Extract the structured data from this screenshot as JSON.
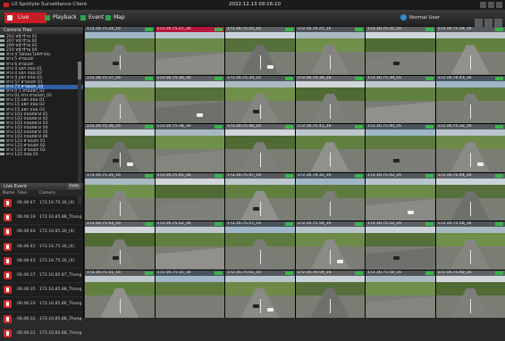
{
  "app": {
    "title": "L0 Spotlyte Surveillance Client",
    "clock": "2022.12.13 09:16:10"
  },
  "toolbar": {
    "tabs": [
      {
        "label": "Live"
      },
      {
        "label": "Playback"
      },
      {
        "label": "Event"
      },
      {
        "label": "Map"
      }
    ],
    "user_label": "Normal User"
  },
  "camera_tree": {
    "title": "Camera Tree",
    "items": [
      "203 หน้าร้าน 01",
      "207 หน้าร้าน 02",
      "209 หน้าร้าน 03",
      "210 หน้าร้าน 04",
      "ทาง 4 ไปถนน ไม่ทราบน",
      "ทาง 5 สามแยก",
      "ทาง 6 สามแยก",
      "ทาง 4 แยก ถนน 01",
      "ทาง 4 แยก ถนน 02",
      "ทาง 4 แยก ถนน 03",
      "ทาง 57 สามแยก 01",
      "ทาง 73 สามแยก_02",
      "ทาง 0 1 สามแยก_01",
      "ทาง 01 ทาง สามแยก_02",
      "ทาง 15 แยก ถนน 01",
      "ทาง 15 แยก ถนน 02",
      "ทาง 15 แยก ถนน 03",
      "ทาง 103 ถนนหลวง 01",
      "ทาง 103 ถนนหลวง 02",
      "ทาง 103 ถนนหลวง 03",
      "ทาง 103 ถนนหลวง 04",
      "ทาง 103 ถนนหลวง 05",
      "ทาง 103 ถนนหลวง 06",
      "ทาง 123 สามแยก 01",
      "ทาง 123 สามแยก 02",
      "ทาง 123 สามแยก 03",
      "ทาง 123 ถนน 01"
    ],
    "selected_index": 11
  },
  "live_event": {
    "title": "Live Event",
    "auto_label": "Auto",
    "columns": {
      "icon": "Name",
      "time": "Time",
      "camera": "Camera"
    },
    "rows": [
      {
        "time": "06:46:47",
        "camera": "172.16.75.30_(4)"
      },
      {
        "time": "06:46:19",
        "camera": "172.16.85.88_Thong"
      },
      {
        "time": "06:46:44",
        "camera": "172.16.85.30_(4)"
      },
      {
        "time": "06:46:42",
        "camera": "172.16.75.30_(4)"
      },
      {
        "time": "06:46:43",
        "camera": "172.16.75.30_(4)"
      },
      {
        "time": "06:46:37",
        "camera": "172.16.85.87_Thong"
      },
      {
        "time": "06:46:35",
        "camera": "172.16.85.88_Thong"
      },
      {
        "time": "06:46:33",
        "camera": "172.16.85.86_Thong"
      },
      {
        "time": "06:46:32",
        "camera": "172.16.85.88_Thong"
      },
      {
        "time": "06:46:31",
        "camera": "172.16.85.88_Thong"
      }
    ]
  },
  "cameras": [
    "172.16.75.24_16",
    "172.16.75.27_16",
    "172.16.75.25_16",
    "172.16.70.25_16",
    "172.16.75.31_16",
    "172.16.75.29_16",
    "172.16.75.37_16",
    "172.16.75.30_16",
    "172.16.75.34_16",
    "172.16.70.34_16",
    "172.16.75.39_16",
    "172.16.70.43_16",
    "172.16.75.36_16",
    "172.16.75.38_16",
    "172.16.75.46_16",
    "172.16.75.41_16",
    "172.16.75.40_16",
    "172.16.75.32_16",
    "172.16.75.35_16",
    "172.16.75.45_16",
    "172.16.75.47_16",
    "172.16.70.32_16",
    "172.16.75.42_16",
    "172.16.75.44_16",
    "172.16.75.43_16",
    "172.16.75.53_16",
    "172.16.75.57_16",
    "172.16.75.54_16",
    "172.16.75.52_16",
    "172.16.75.56_16",
    "172.16.75.51_16",
    "172.16.75.55_16",
    "172.16.75.61_16",
    "172.16.70.59_16",
    "172.16.75.58_16",
    "172.16.75.60_16"
  ],
  "colors": {
    "live_tab": "#c81d25",
    "highlight_caption": "#b4173c",
    "selection": "#2e5fa8",
    "status_ok": "#38b54a"
  }
}
